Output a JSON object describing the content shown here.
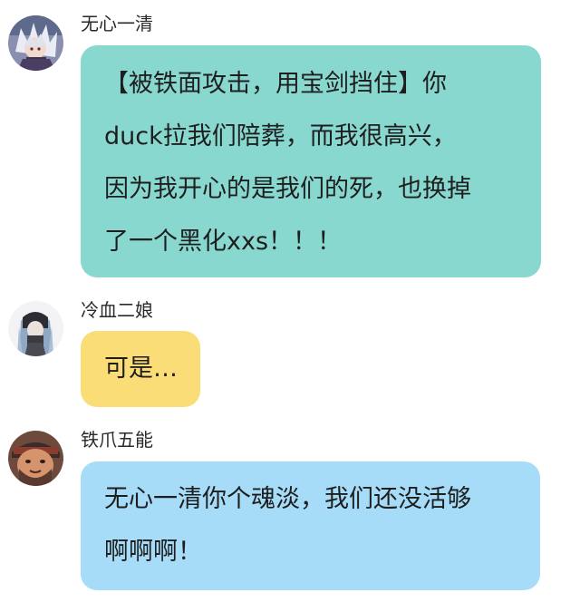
{
  "messages": [
    {
      "sender": "无心一清",
      "avatar_icon": "anime-character-avatar-icon",
      "bubble_color": "#88d8d0",
      "lines": [
        "【被铁面攻击，用宝剑挡住】你",
        "duck拉我们陪葬，而我很高兴，",
        "因为我开心的是我们的死，也换掉",
        "了一个黑化xxs！！！"
      ]
    },
    {
      "sender": "冷血二娘",
      "avatar_icon": "long-hair-character-avatar-icon",
      "bubble_color": "#fbdd78",
      "lines": [
        "可是…"
      ]
    },
    {
      "sender": "铁爪五能",
      "avatar_icon": "bearded-character-avatar-icon",
      "bubble_color": "#a6dcf7",
      "lines": [
        "无心一清你个魂淡，我们还没活够",
        "啊啊啊！"
      ]
    }
  ]
}
